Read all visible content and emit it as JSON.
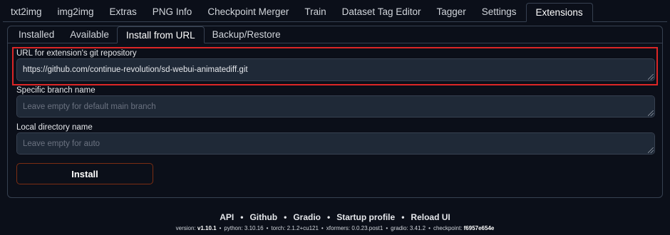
{
  "top_tabs": [
    "txt2img",
    "img2img",
    "Extras",
    "PNG Info",
    "Checkpoint Merger",
    "Train",
    "Dataset Tag Editor",
    "Tagger",
    "Settings",
    "Extensions"
  ],
  "top_tab_active": "Extensions",
  "sub_tabs": [
    "Installed",
    "Available",
    "Install from URL",
    "Backup/Restore"
  ],
  "sub_tab_active": "Install from URL",
  "form": {
    "url_label": "URL for extension's git repository",
    "url_value": "https://github.com/continue-revolution/sd-webui-animatediff.git",
    "branch_label": "Specific branch name",
    "branch_placeholder": "Leave empty for default main branch",
    "dir_label": "Local directory name",
    "dir_placeholder": "Leave empty for auto",
    "install_label": "Install"
  },
  "footer": {
    "links": [
      "API",
      "Github",
      "Gradio",
      "Startup profile",
      "Reload UI"
    ],
    "separator": "•",
    "versions": [
      {
        "key": "version:",
        "value": "v1.10.1"
      },
      {
        "key": "python:",
        "value": "3.10.16"
      },
      {
        "key": "torch:",
        "value": "2.1.2+cu121"
      },
      {
        "key": "xformers:",
        "value": "0.0.23.post1"
      },
      {
        "key": "gradio:",
        "value": "3.41.2"
      },
      {
        "key": "checkpoint:",
        "value": "f6957e654e"
      }
    ]
  },
  "colors": {
    "background": "#0b0f19",
    "input_bg": "#1f2937",
    "border": "#374151",
    "highlight": "#dc2626",
    "install_border": "#7c2d12"
  }
}
